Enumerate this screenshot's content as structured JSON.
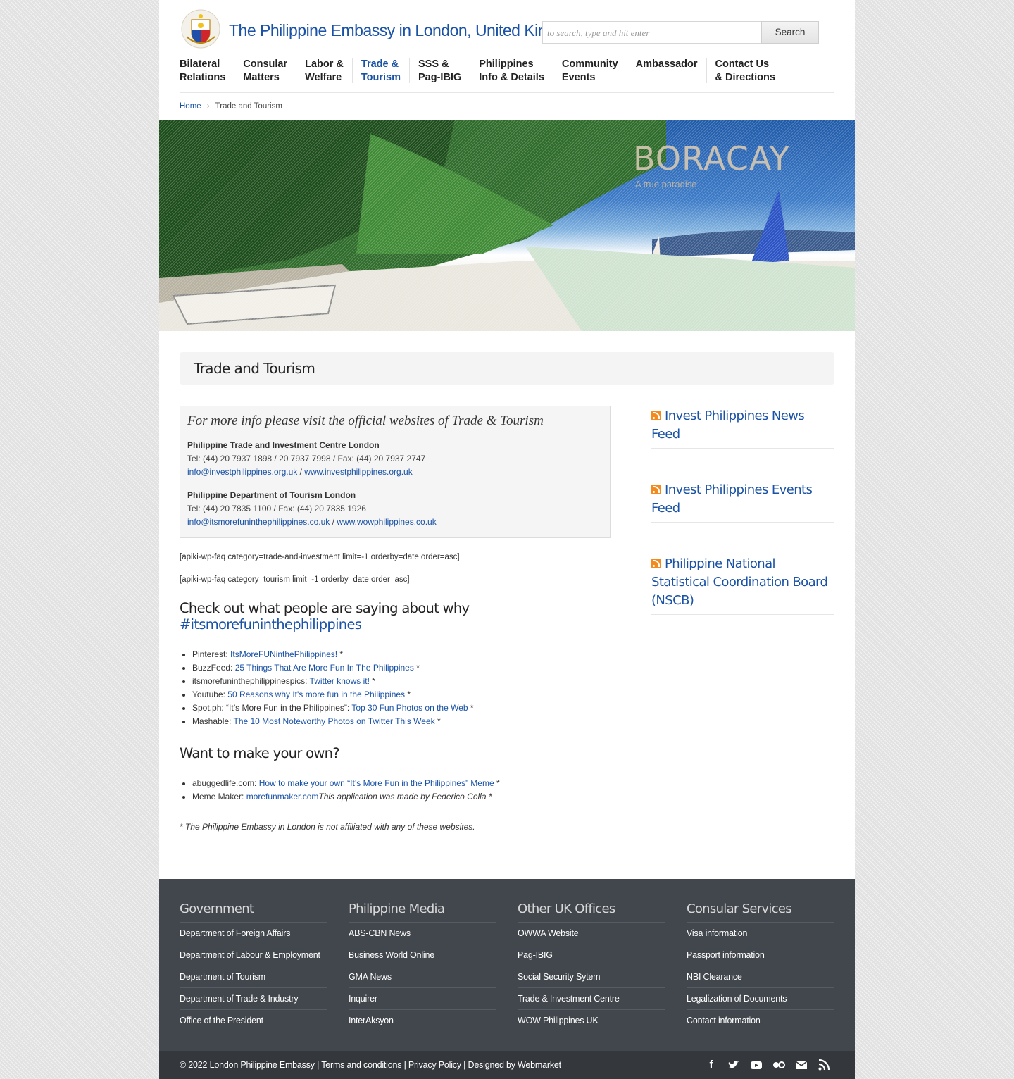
{
  "header": {
    "site_title": "The Philippine Embassy in London, United Kingdom",
    "search_placeholder": "to search, type and hit enter",
    "search_button": "Search"
  },
  "nav": {
    "items": [
      {
        "line1": "Bilateral",
        "line2": "Relations"
      },
      {
        "line1": "Consular",
        "line2": "Matters"
      },
      {
        "line1": "Labor &",
        "line2": "Welfare"
      },
      {
        "line1": "Trade &",
        "line2": "Tourism",
        "active": true
      },
      {
        "line1": "SSS &",
        "line2": "Pag-IBIG"
      },
      {
        "line1": "Philippines",
        "line2": "Info & Details"
      },
      {
        "line1": "Community",
        "line2": "Events"
      },
      {
        "line1": "Ambassador",
        "line2": ""
      },
      {
        "line1": "Contact Us",
        "line2": "& Directions"
      }
    ]
  },
  "breadcrumb": {
    "home": "Home",
    "current": "Trade and Tourism"
  },
  "hero": {
    "title": "BORACAY",
    "subtitle": "A true paradise"
  },
  "page_title": "Trade and Tourism",
  "info_box": {
    "title": "For more info please visit the official websites of Trade & Tourism",
    "orgs": [
      {
        "name": "Philippine Trade and Investment Centre London",
        "tel": "Tel: (44) 20 7937 1898 / 20 7937 7998 / Fax: (44) 20 7937 2747",
        "email": "info@investphilippines.org.uk",
        "sep": " / ",
        "website": "www.investphilippines.org.uk"
      },
      {
        "name": "Philippine Department of Tourism London",
        "tel": "Tel: (44) 20 7835 1100 / Fax: (44) 20 7835 1926",
        "email": "info@itsmorefuninthephilippines.co.uk",
        "sep": " / ",
        "website": "www.wowphilippines.co.uk"
      }
    ]
  },
  "shortcodes": [
    "[apiki-wp-faq category=trade-and-investment limit=-1 orderby=date order=asc]",
    "[apiki-wp-faq category=tourism limit=-1 orderby=date order=asc]"
  ],
  "section1": {
    "heading": "Check out what people are saying about why ",
    "hashtag": "#itsmorefuninthephilippines",
    "items": [
      {
        "prefix": "Pinterest: ",
        "link": "ItsMoreFUNinthePhilippines!",
        "suffix": " *"
      },
      {
        "prefix": "BuzzFeed: ",
        "link": "25 Things That Are More Fun In The Philippines",
        "suffix": " *"
      },
      {
        "prefix": "itsmorefuninthephilippinespics: ",
        "link": "Twitter knows it!",
        "suffix": " *"
      },
      {
        "prefix": "Youtube: ",
        "link": "50 Reasons why It's more fun in the Philippines",
        "suffix": " *"
      },
      {
        "prefix": "Spot.ph: “It’s More Fun in the Philippines”: ",
        "link": "Top 30 Fun Photos on the Web",
        "suffix": " *"
      },
      {
        "prefix": "Mashable: ",
        "link": "The 10 Most Noteworthy Photos on Twitter This Week",
        "suffix": " *"
      }
    ]
  },
  "section2": {
    "heading": "Want to make your own?",
    "items": [
      {
        "prefix": "abuggedlife.com: ",
        "link": "How to make your own “It’s More Fun in the Philippines” Meme",
        "suffix": " *",
        "italic_suffix": ""
      },
      {
        "prefix": "Meme Maker: ",
        "link": "morefunmaker.com",
        "suffix": "",
        "italic_suffix": "This application was made by Federico Colla *"
      }
    ]
  },
  "disclaimer": "* The Philippine Embassy in London is not affiliated with any of these websites.",
  "sidebar": {
    "widgets": [
      "Invest Philippines News Feed",
      "Invest Philippines Events Feed",
      "Philippine National Statistical Coordination Board (NSCB)"
    ]
  },
  "footer": {
    "columns": [
      {
        "title": "Government",
        "links": [
          "Department of Foreign Affairs",
          "Department of Labour & Employment",
          "Department of Tourism",
          "Department of Trade & Industry",
          "Office of the President"
        ]
      },
      {
        "title": "Philippine Media",
        "links": [
          "ABS-CBN News",
          "Business World Online",
          "GMA News",
          "Inquirer",
          "InterAksyon"
        ]
      },
      {
        "title": "Other UK Offices",
        "links": [
          "OWWA Website",
          "Pag-IBIG",
          "Social Security Sytem",
          "Trade & Investment Centre",
          "WOW Philippines UK"
        ]
      },
      {
        "title": "Consular Services",
        "links": [
          "Visa information",
          "Passport information",
          "NBI Clearance",
          "Legalization of Documents",
          "Contact information"
        ]
      }
    ],
    "copyright": "© 2022 London Philippine Embassy | Terms and conditions | Privacy Policy | Designed by Webmarket",
    "social_icons": [
      "facebook-icon",
      "twitter-icon",
      "youtube-icon",
      "flickr-icon",
      "email-icon",
      "rss-icon"
    ]
  },
  "colors": {
    "link_blue": "#1a52a5",
    "footer_bg": "#42474d",
    "footer_bottom_bg": "#34383d",
    "rss_orange": "#f28a1e"
  }
}
